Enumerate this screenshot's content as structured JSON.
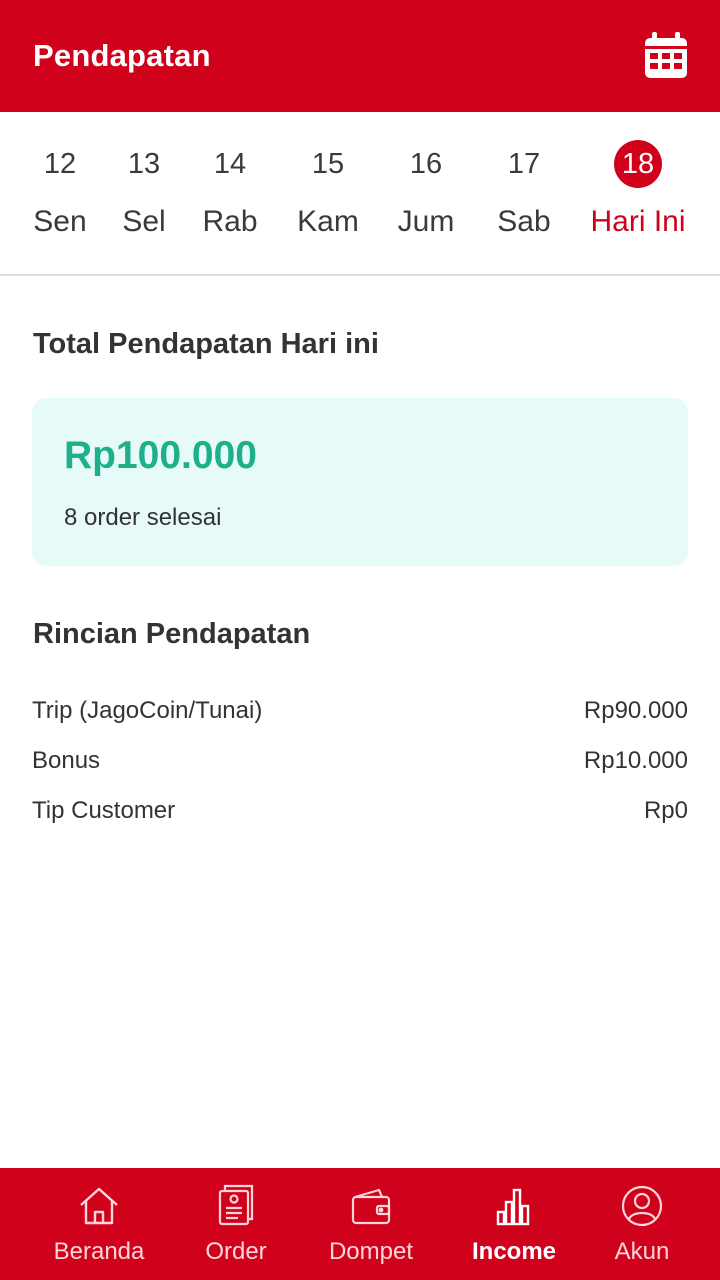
{
  "header": {
    "title": "Pendapatan",
    "calendar_icon": "calendar-icon"
  },
  "date_strip": {
    "days": [
      {
        "num": "12",
        "name": "Sen"
      },
      {
        "num": "13",
        "name": "Sel"
      },
      {
        "num": "14",
        "name": "Rab"
      },
      {
        "num": "15",
        "name": "Kam"
      },
      {
        "num": "16",
        "name": "Jum"
      },
      {
        "num": "17",
        "name": "Sab"
      },
      {
        "num": "18",
        "name": "Hari Ini"
      }
    ],
    "selected": "18"
  },
  "summary": {
    "title": "Total Pendapatan Hari ini",
    "amount": "Rp100.000",
    "orders": "8 order selesai"
  },
  "details": {
    "title": "Rincian Pendapatan",
    "rows": [
      {
        "label": "Trip (JagoCoin/Tunai)",
        "value": "Rp90.000"
      },
      {
        "label": "Bonus",
        "value": "Rp10.000"
      },
      {
        "label": "Tip Customer",
        "value": "Rp0"
      }
    ]
  },
  "nav": {
    "items": [
      {
        "label": "Beranda",
        "icon": "home-icon"
      },
      {
        "label": "Order",
        "icon": "order-list-icon"
      },
      {
        "label": "Dompet",
        "icon": "wallet-icon"
      },
      {
        "label": "Income",
        "icon": "bar-chart-icon"
      },
      {
        "label": "Akun",
        "icon": "user-icon"
      }
    ],
    "active": "Income"
  },
  "colors": {
    "brand": "#d0021b",
    "income_green": "#1fb08b",
    "card_bg": "#e6fbf7"
  }
}
